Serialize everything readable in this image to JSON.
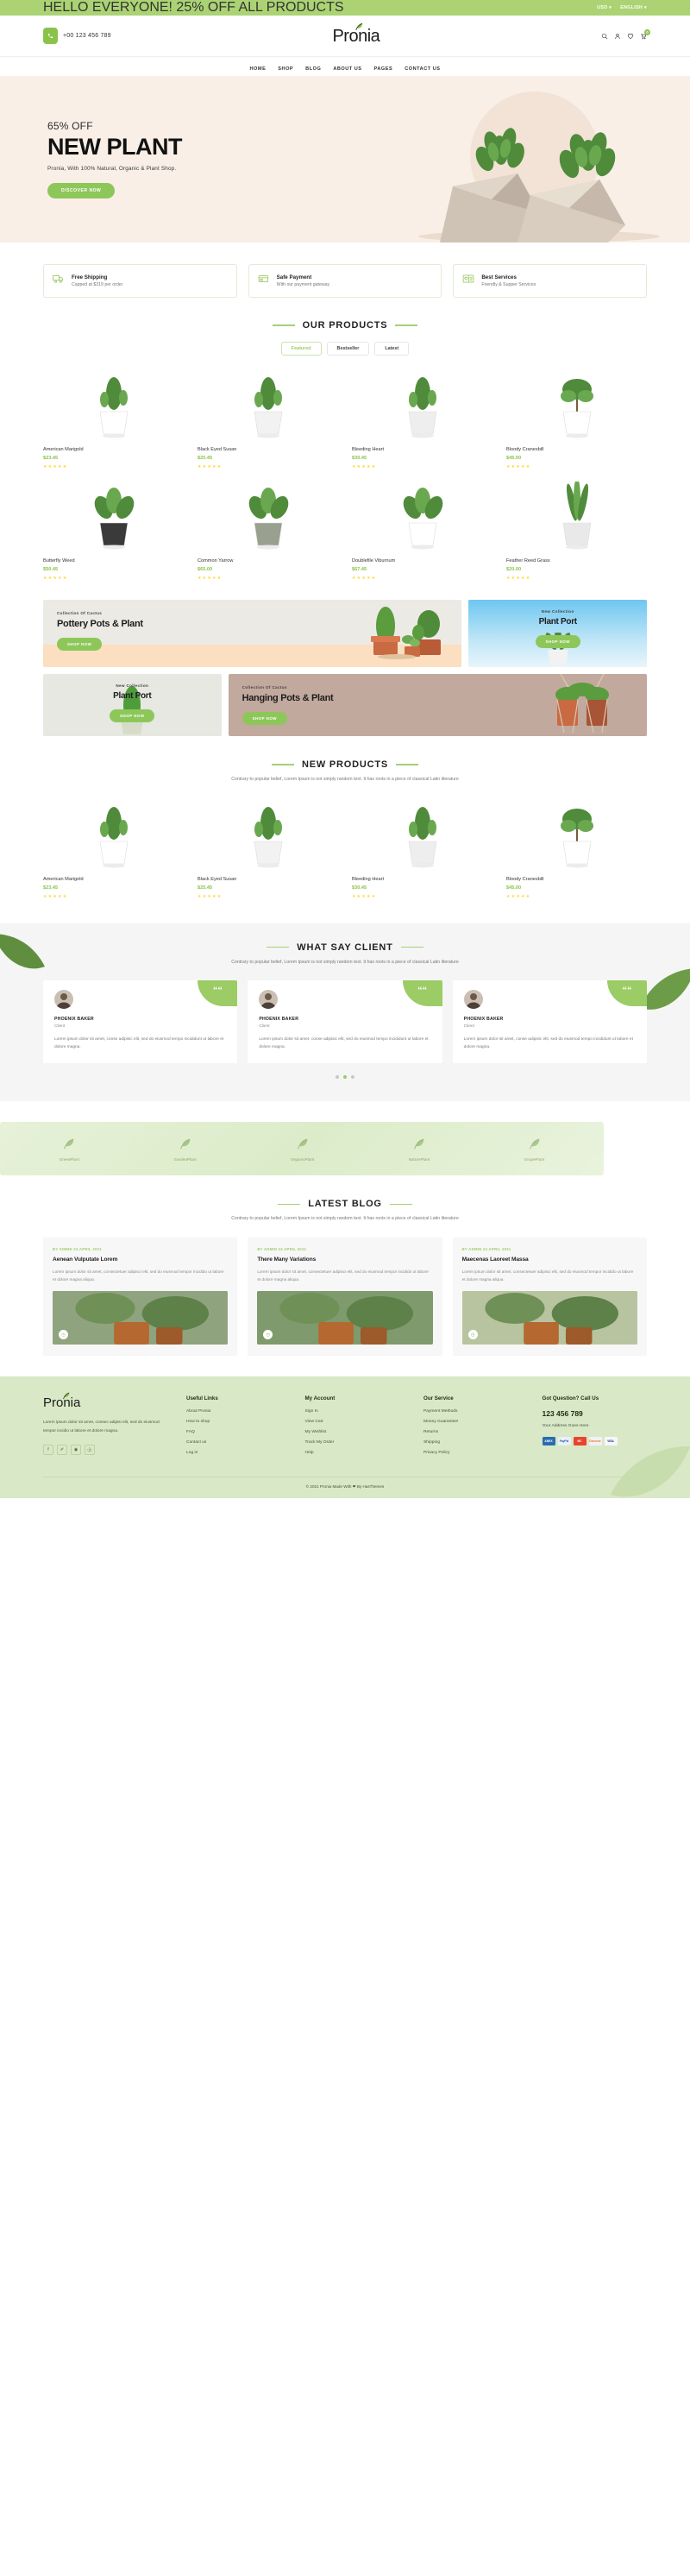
{
  "topbar": {
    "message": "HELLO EVERYONE! 25% OFF ALL PRODUCTS",
    "currency": "USD",
    "language": "ENGLISH",
    "caret": "▾"
  },
  "header": {
    "phone": "+00 123 456 789",
    "logo": "Pronia",
    "icons": {
      "search": "search-icon",
      "user": "user-icon",
      "wishlist": "heart-icon",
      "cart": "cart-icon"
    },
    "cart_count": "0"
  },
  "nav": {
    "items": [
      {
        "label": "HOME"
      },
      {
        "label": "SHOP"
      },
      {
        "label": "BLOG"
      },
      {
        "label": "ABOUT US"
      },
      {
        "label": "PAGES"
      },
      {
        "label": "CONTACT US"
      }
    ]
  },
  "hero": {
    "offer": "65% OFF",
    "title": "NEW PLANT",
    "subtitle": "Pronia, With 100% Natural, Organic & Plant Shop.",
    "cta": "DISCOVER NOW"
  },
  "services": [
    {
      "icon": "truck-icon",
      "title": "Free Shipping",
      "subtitle": "Capped at $319 per order"
    },
    {
      "icon": "credit-card-icon",
      "title": "Safe Payment",
      "subtitle": "With our payment gateway"
    },
    {
      "icon": "support-icon",
      "title": "Best Services",
      "subtitle": "Friendly & Supper Services"
    }
  ],
  "products_section": {
    "title": "OUR PRODUCTS",
    "tabs": [
      {
        "label": "Featured",
        "active": true
      },
      {
        "label": "Bestseller",
        "active": false
      },
      {
        "label": "Latest",
        "active": false
      }
    ],
    "items": [
      {
        "name": "American Marigold",
        "price": "$23.45",
        "rating": 5
      },
      {
        "name": "Black Eyed Susan",
        "price": "$25.45",
        "rating": 5
      },
      {
        "name": "Bleeding Heart",
        "price": "$30.45",
        "rating": 5
      },
      {
        "name": "Bloody Cranesbill",
        "price": "$45.00",
        "rating": 5
      },
      {
        "name": "Butterfly Weed",
        "price": "$50.45",
        "rating": 5
      },
      {
        "name": "Common Yarrow",
        "price": "$65.00",
        "rating": 5
      },
      {
        "name": "Doublefile Viburnum",
        "price": "$67.45",
        "rating": 5
      },
      {
        "name": "Feather Reed Grass",
        "price": "$20.00",
        "rating": 5
      }
    ]
  },
  "promos": [
    {
      "kicker": "Collection Of Cactus",
      "title": "Pottery Pots & Plant",
      "cta": "SHOP NOW"
    },
    {
      "kicker": "New Collection",
      "title": "Plant Port",
      "cta": "SHOP NOW"
    },
    {
      "kicker": "New Collection",
      "title": "Plant Port",
      "cta": "SHOP NOW"
    },
    {
      "kicker": "Collection Of Cactus",
      "title": "Hanging Pots & Plant",
      "cta": "SHOP NOW"
    }
  ],
  "new_products": {
    "title": "NEW PRODUCTS",
    "description": "Contrary to popular belief, Lorem Ipsum is not simply random text. It has roots in a piece of classical Latin literature",
    "items": [
      {
        "name": "American Marigold",
        "price": "$23.45",
        "rating": 5
      },
      {
        "name": "Black Eyed Susan",
        "price": "$25.45",
        "rating": 5
      },
      {
        "name": "Bleeding Heart",
        "price": "$30.45",
        "rating": 5
      },
      {
        "name": "Bloody Cranesbill",
        "price": "$45.00",
        "rating": 5
      }
    ]
  },
  "testimonials": {
    "title": "WHAT SAY CLIENT",
    "description": "Contrary to popular belief, Lorem Ipsum is not simply random text. It has roots in a piece of classical Latin literature",
    "items": [
      {
        "name": "PHOENIX BAKER",
        "role": "Client",
        "text": "Lorem ipsum dolor sit amet, conse adipisic elit, sed do eiusmod tempo incididunt ut labore et dolore magna."
      },
      {
        "name": "PHOENIX BAKER",
        "role": "Client",
        "text": "Lorem ipsum dolor sit amet, conse adipisic elit, sed do eiusmod tempo incididunt ut labore et dolore magna."
      },
      {
        "name": "PHOENIX BAKER",
        "role": "Client",
        "text": "Lorem ipsum dolor sit amet, conse adipisic elit, sed do eiusmod tempo incididunt ut labore et dolore magna."
      }
    ],
    "dots": 3,
    "active_dot": 1
  },
  "brands": [
    {
      "name": "GreenPlant"
    },
    {
      "name": "GardenPlant"
    },
    {
      "name": "OrganicPlant"
    },
    {
      "name": "NaturePlant"
    },
    {
      "name": "GrapePlant"
    }
  ],
  "blog": {
    "title": "LATEST BLOG",
    "description": "Contrary to popular belief, Lorem Ipsum is not simply random text. It has roots in a piece of classical Latin literature",
    "posts": [
      {
        "meta": "BY ADMIN  24 APRIL 2021",
        "title": "Aenean Vulputate Lorem",
        "desc": "Lorem ipsum dolor sit amet, consectetuer adipisci elit, sed do eiusmod tempor incidido ut labore et dolore magna aliqua."
      },
      {
        "meta": "BY ADMIN  24 APRIL 2021",
        "title": "There Many Variations",
        "desc": "Lorem ipsum dolor sit amet, consectetuer adipisci elit, sed do eiusmod tempor incidido ut labore et dolore magna aliqua."
      },
      {
        "meta": "BY ADMIN  24 APRIL 2021",
        "title": "Maecenas Laoreet Massa",
        "desc": "Lorem ipsum dolor sit amet, consectetuer adipisci elit, sed do eiusmod tempor incidido ut labore et dolore magna aliqua."
      }
    ]
  },
  "footer": {
    "logo": "Pronia",
    "about": "Lorem ipsum dolor sit amet, consec adipisi elit, sed do eiusmod tempor incidio ut labore et dolore magna.",
    "social": [
      {
        "icon": "facebook-icon",
        "glyph": "f"
      },
      {
        "icon": "twitter-icon",
        "glyph": "✐"
      },
      {
        "icon": "instagram-icon",
        "glyph": "◉"
      },
      {
        "icon": "dribbble-icon",
        "glyph": "ⓓ"
      }
    ],
    "columns": [
      {
        "heading": "Useful Links",
        "links": [
          "About Pronia",
          "How to shop",
          "FAQ",
          "Contact us",
          "Log in"
        ]
      },
      {
        "heading": "My Account",
        "links": [
          "Sign In",
          "View Cart",
          "My Wishlist",
          "Track My Order",
          "Help"
        ]
      },
      {
        "heading": "Our Service",
        "links": [
          "Payment Methods",
          "Money Guarantee!",
          "Returns",
          "Shipping",
          "Privacy Policy"
        ]
      }
    ],
    "contact": {
      "heading": "Got Question? Call Us",
      "phone": "123 456 789",
      "address": "Your Address Goes Here"
    },
    "payments": [
      "AMEX",
      "PayPal",
      "MC",
      "Discover",
      "VISA"
    ],
    "copyright": "© 2021 Pronia Made With ❤ By HasThemes"
  },
  "colors": {
    "green": "#8bc34a",
    "green_light": "#abd373",
    "hero_bg": "#f9efe7",
    "star": "#fdd835",
    "footer_bg": "#d9e8c6"
  }
}
